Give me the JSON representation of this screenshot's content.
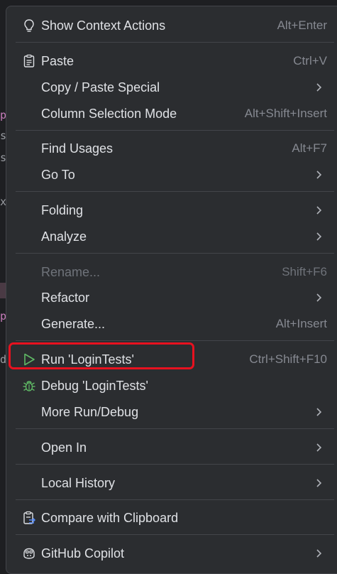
{
  "menu": {
    "items": [
      {
        "id": "show-context-actions",
        "label": "Show Context Actions",
        "shortcut": "Alt+Enter",
        "icon": "bulb-icon"
      },
      {
        "id": "paste",
        "label": "Paste",
        "shortcut": "Ctrl+V",
        "icon": "clipboard-icon"
      },
      {
        "id": "copy-paste-special",
        "label": "Copy / Paste Special",
        "submenu": true
      },
      {
        "id": "column-selection-mode",
        "label": "Column Selection Mode",
        "shortcut": "Alt+Shift+Insert"
      },
      {
        "id": "find-usages",
        "label": "Find Usages",
        "shortcut": "Alt+F7"
      },
      {
        "id": "go-to",
        "label": "Go To",
        "submenu": true
      },
      {
        "id": "folding",
        "label": "Folding",
        "submenu": true
      },
      {
        "id": "analyze",
        "label": "Analyze",
        "submenu": true
      },
      {
        "id": "rename",
        "label": "Rename...",
        "shortcut": "Shift+F6",
        "disabled": true
      },
      {
        "id": "refactor",
        "label": "Refactor",
        "submenu": true
      },
      {
        "id": "generate",
        "label": "Generate...",
        "shortcut": "Alt+Insert"
      },
      {
        "id": "run",
        "label": "Run 'LoginTests'",
        "shortcut": "Ctrl+Shift+F10",
        "icon": "run-play-icon"
      },
      {
        "id": "debug",
        "label": "Debug 'LoginTests'",
        "icon": "debug-bug-icon"
      },
      {
        "id": "more-run-debug",
        "label": "More Run/Debug",
        "submenu": true
      },
      {
        "id": "open-in",
        "label": "Open In",
        "submenu": true
      },
      {
        "id": "local-history",
        "label": "Local History",
        "submenu": true
      },
      {
        "id": "compare-clipboard",
        "label": "Compare with Clipboard",
        "icon": "compare-clipboard-icon"
      },
      {
        "id": "github-copilot",
        "label": "GitHub Copilot",
        "submenu": true,
        "icon": "copilot-icon"
      }
    ]
  },
  "colors": {
    "menu_bg": "#2b2d30",
    "text": "#dfe1e5",
    "shortcut": "#868991",
    "disabled": "#6f737a",
    "separator": "#43454a",
    "run_green": "#5fb865",
    "highlight_red": "#e8111f"
  }
}
